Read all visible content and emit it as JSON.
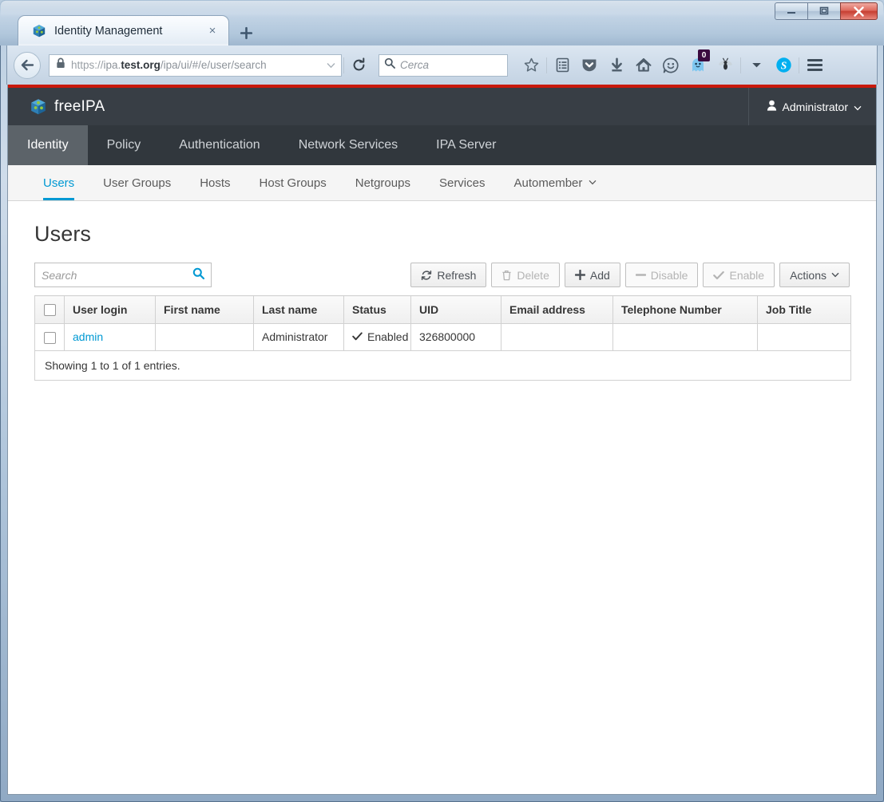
{
  "window": {
    "minimize_label": "Minimize",
    "maximize_label": "Maximize",
    "close_label": "Close"
  },
  "browser": {
    "tab": {
      "title": "Identity Management",
      "favicon": "freeipa-cube-icon",
      "close_label": "×"
    },
    "new_tab_label": "+",
    "back_label": "Back",
    "address_bar": {
      "scheme": "https://",
      "host_prefix": "ipa.",
      "host_bold": "test.org",
      "path": "/ipa/ui/#/e/user/search",
      "full_url": "https://ipa.test.org/ipa/ui/#/e/user/search",
      "lock_icon": "padlock-icon",
      "dropdown_icon": "chevron-down-icon"
    },
    "reload_label": "Reload",
    "search": {
      "placeholder": "Cerca",
      "icon": "search-icon"
    },
    "toolbar_icons": [
      {
        "name": "bookmark-star-icon",
        "badge": null
      },
      {
        "name": "reading-list-icon",
        "badge": null
      },
      {
        "name": "pocket-shield-icon",
        "badge": null
      },
      {
        "name": "downloads-arrow-icon",
        "badge": null
      },
      {
        "name": "home-icon",
        "badge": null
      },
      {
        "name": "smiley-face-icon",
        "badge": null
      },
      {
        "name": "ghostery-ghost-icon",
        "badge": "0"
      },
      {
        "name": "flash-block-fly-icon",
        "badge": null
      },
      {
        "name": "overflow-chevron-down-icon",
        "badge": null
      },
      {
        "name": "skype-icon",
        "badge": null
      },
      {
        "name": "hamburger-menu-icon",
        "badge": null
      }
    ]
  },
  "app": {
    "brand": {
      "name_prefix": "free",
      "name_suffix": "IPA",
      "logo": "freeipa-cube-icon"
    },
    "user_menu": {
      "label": "Administrator",
      "icon": "user-icon",
      "caret": "chevron-down-icon"
    },
    "primary_nav": [
      {
        "label": "Identity",
        "active": true
      },
      {
        "label": "Policy",
        "active": false
      },
      {
        "label": "Authentication",
        "active": false
      },
      {
        "label": "Network Services",
        "active": false
      },
      {
        "label": "IPA Server",
        "active": false
      }
    ],
    "secondary_nav": [
      {
        "label": "Users",
        "active": true,
        "caret": false
      },
      {
        "label": "User Groups",
        "active": false,
        "caret": false
      },
      {
        "label": "Hosts",
        "active": false,
        "caret": false
      },
      {
        "label": "Host Groups",
        "active": false,
        "caret": false
      },
      {
        "label": "Netgroups",
        "active": false,
        "caret": false
      },
      {
        "label": "Services",
        "active": false,
        "caret": false
      },
      {
        "label": "Automember",
        "active": false,
        "caret": true
      }
    ],
    "page_title": "Users",
    "search": {
      "placeholder": "Search",
      "value": "",
      "icon": "search-icon"
    },
    "toolbar": [
      {
        "label": "Refresh",
        "icon": "refresh-icon",
        "disabled": false,
        "name": "refresh-button"
      },
      {
        "label": "Delete",
        "icon": "trash-icon",
        "disabled": true,
        "name": "delete-button"
      },
      {
        "label": "Add",
        "icon": "plus-icon",
        "disabled": false,
        "name": "add-button"
      },
      {
        "label": "Disable",
        "icon": "minus-icon",
        "disabled": true,
        "name": "disable-button"
      },
      {
        "label": "Enable",
        "icon": "check-icon",
        "disabled": true,
        "name": "enable-button"
      },
      {
        "label": "Actions",
        "icon": "chevron-down-icon",
        "disabled": false,
        "name": "actions-menu-button"
      }
    ],
    "table": {
      "columns": [
        "User login",
        "First name",
        "Last name",
        "Status",
        "UID",
        "Email address",
        "Telephone Number",
        "Job Title"
      ],
      "rows": [
        {
          "selected": false,
          "user_login": "admin",
          "first_name": "",
          "last_name": "Administrator",
          "status": "Enabled",
          "status_icon": "check-icon",
          "uid": "326800000",
          "email": "",
          "phone": "",
          "job_title": ""
        }
      ],
      "footer": "Showing 1 to 1 of 1 entries."
    }
  },
  "colors": {
    "accent": "#0099d3",
    "header_bg": "#383e45",
    "nav_bg": "#31373d",
    "nav_active_bg": "#5c6369",
    "alert_red": "#c9190b",
    "subnav_bg": "#f5f5f5"
  }
}
